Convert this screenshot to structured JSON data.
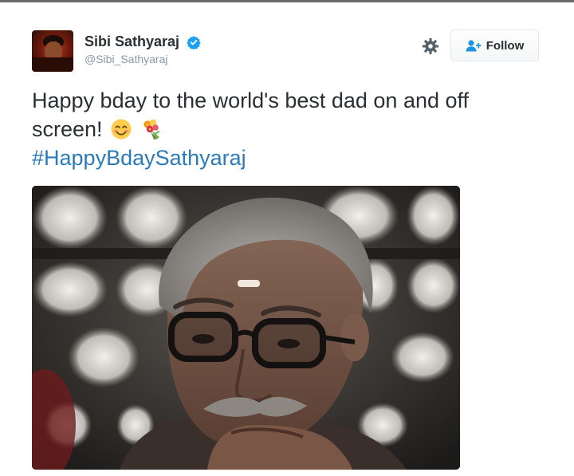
{
  "tweet": {
    "author": {
      "display_name": "Sibi Sathyaraj",
      "handle": "@Sibi_Sathyaraj",
      "verified": true
    },
    "follow_label": "Follow",
    "text_line1": "Happy bday to the world's best dad on and off",
    "text_line2": "screen!",
    "emoji": [
      "smiling-face-with-smiling-eyes",
      "bouquet"
    ],
    "hashtag": "#HappyBdaySathyaraj",
    "colors": {
      "hashtag": "#2b7bb9",
      "verified": "#1da1f2",
      "name": "#292f33",
      "handle": "#8899a6"
    }
  }
}
